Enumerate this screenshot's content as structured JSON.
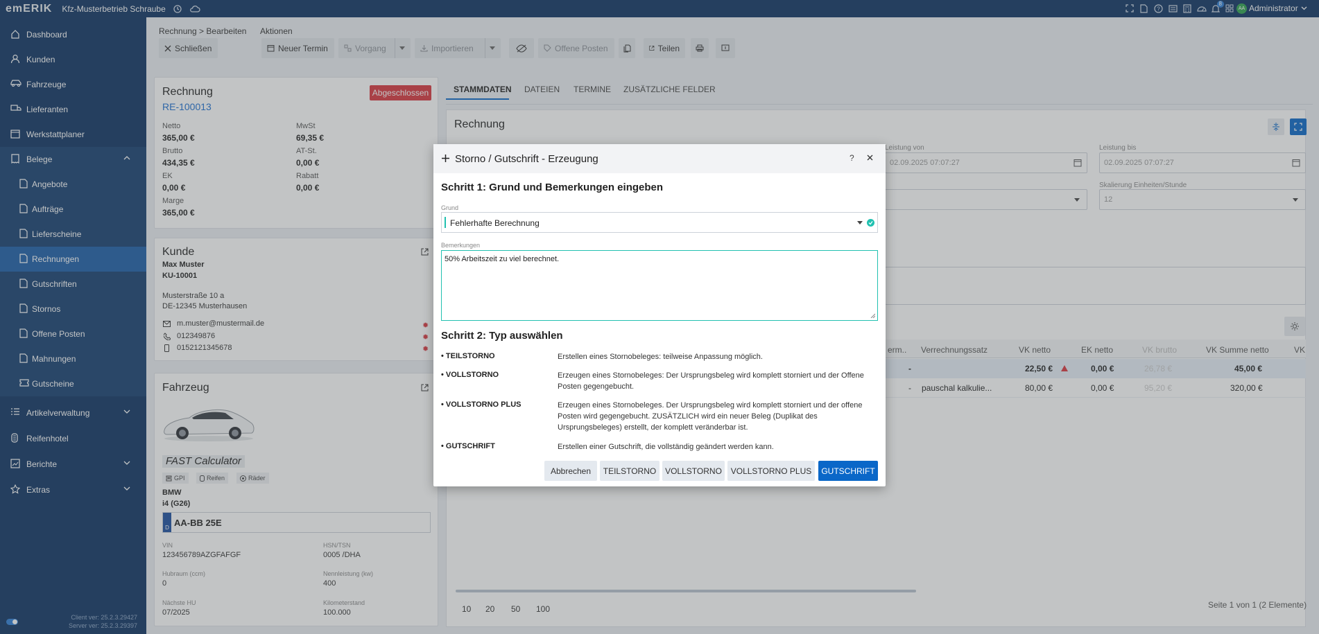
{
  "topbar": {
    "logo": "emERIK",
    "company": "Kfz-Musterbetrieb Schraube",
    "user": "Administrator",
    "avatar_initials": "AA",
    "notifications_count": "8"
  },
  "sidebar": {
    "items": [
      {
        "label": "Dashboard",
        "icon": "home-icon"
      },
      {
        "label": "Kunden",
        "icon": "user-icon"
      },
      {
        "label": "Fahrzeuge",
        "icon": "car-icon"
      },
      {
        "label": "Lieferanten",
        "icon": "truck-icon"
      },
      {
        "label": "Werkstattplaner",
        "icon": "calendar-icon"
      },
      {
        "label": "Belege",
        "icon": "receipt-icon"
      },
      {
        "label": "Angebote",
        "icon": "document-icon"
      },
      {
        "label": "Aufträge",
        "icon": "document-icon"
      },
      {
        "label": "Lieferscheine",
        "icon": "document-icon"
      },
      {
        "label": "Rechnungen",
        "icon": "document-icon"
      },
      {
        "label": "Gutschriften",
        "icon": "document-icon"
      },
      {
        "label": "Stornos",
        "icon": "document-icon"
      },
      {
        "label": "Offene Posten",
        "icon": "document-icon"
      },
      {
        "label": "Mahnungen",
        "icon": "document-icon"
      },
      {
        "label": "Gutscheine",
        "icon": "ticket-icon"
      },
      {
        "label": "Artikelverwaltung",
        "icon": "list-icon"
      },
      {
        "label": "Reifenhotel",
        "icon": "tire-icon"
      },
      {
        "label": "Berichte",
        "icon": "chart-icon"
      },
      {
        "label": "Extras",
        "icon": "star-icon"
      }
    ],
    "client_version": "Client ver: 25.2.3.29427",
    "server_version": "Server ver: 25.2.3.29397"
  },
  "toolbar": {
    "breadcrumb": "Rechnung > Bearbeiten",
    "actions_label": "Aktionen",
    "close": "Schließen",
    "new_appointment": "Neuer Termin",
    "process": "Vorgang",
    "import": "Importieren",
    "open_items": "Offene Posten",
    "share": "Teilen"
  },
  "invoice": {
    "title": "Rechnung",
    "number": "RE-100013",
    "status": "Abgeschlossen",
    "netto_label": "Netto",
    "netto": "365,00 €",
    "mwst_label": "MwSt",
    "mwst": "69,35 €",
    "brutto_label": "Brutto",
    "brutto": "434,35 €",
    "atst_label": "AT-St.",
    "atst": "0,00 €",
    "ek_label": "EK",
    "ek": "0,00 €",
    "rabatt_label": "Rabatt",
    "rabatt": "0,00 €",
    "marge_label": "Marge",
    "marge": "365,00 €"
  },
  "customer": {
    "title": "Kunde",
    "name": "Max Muster",
    "number": "KU-10001",
    "street": "Musterstraße 10 a",
    "city": "DE-12345 Musterhausen",
    "email": "m.muster@mustermail.de",
    "phone": "012349876",
    "mobile": "0152121345678"
  },
  "vehicle": {
    "title": "Fahrzeug",
    "calculator": "FAST Calculator",
    "chips": [
      "GPI",
      "Reifen",
      "Räder"
    ],
    "make": "BMW",
    "model": "i4 (G26)",
    "plate_country": "D",
    "plate": "AA-BB 25E",
    "vin_label": "VIN",
    "vin": "123456789AZGFAFGF",
    "hsn_label": "HSN/TSN",
    "hsn": "0005 /DHA",
    "hubraum_label": "Hubraum (ccm)",
    "hubraum": "0",
    "power_label": "Nennleistung (kw)",
    "power": "400",
    "hu_label": "Nächste HU",
    "hu": "07/2025",
    "km_label": "Kilometerstand",
    "km": "100.000"
  },
  "main": {
    "tabs": [
      "STAMMDATEN",
      "DATEIEN",
      "TERMINE",
      "ZUSÄTZLICHE FELDER"
    ],
    "section_title": "Rechnung",
    "leistung_von_label": "Leistung von",
    "leistung_von": "02.09.2025 07:07:27",
    "leistung_bis_label": "Leistung bis",
    "leistung_bis": "02.09.2025 07:07:27",
    "skalierung_label": "Skalierung Einheiten/Stunde",
    "skalierung": "12",
    "table_headers": [
      "erm..",
      "Verrechnungssatz",
      "VK netto",
      "EK netto",
      "VK brutto",
      "VK Summe netto",
      "VK"
    ],
    "rows": [
      {
        "erm": "-",
        "satz": "",
        "vk_netto": "22,50 €",
        "ek_netto": "0,00 €",
        "vk_brutto": "26,78 €",
        "vk_summe": "45,00 €"
      },
      {
        "erm": "-",
        "satz": "pauschal kalkulie...",
        "vk_netto": "80,00 €",
        "ek_netto": "0,00 €",
        "vk_brutto": "95,20 €",
        "vk_summe": "320,00 €"
      }
    ],
    "page_sizes": [
      "10",
      "20",
      "50",
      "100"
    ],
    "page_info": "Seite 1 von 1 (2 Elemente)"
  },
  "dialog": {
    "title": "Storno / Gutschrift - Erzeugung",
    "help": "?",
    "step1": "Schritt 1: Grund und Bemerkungen eingeben",
    "grund_label": "Grund",
    "grund_value": "Fehlerhafte Berechnung",
    "bemerkungen_label": "Bemerkungen",
    "bemerkungen_value": "50% Arbeitszeit zu viel berechnet.",
    "step2": "Schritt 2: Typ auswählen",
    "types": [
      {
        "name": "• TEILSTORNO",
        "desc": "Erstellen eines Stornobeleges: teilweise Anpassung möglich."
      },
      {
        "name": "• VOLLSTORNO",
        "desc": "Erzeugen eines Stornobeleges: Der Ursprungsbeleg wird komplett storniert und der Offene Posten gegengebucht."
      },
      {
        "name": "• VOLLSTORNO PLUS",
        "desc": "Erzeugen eines Stornobeleges. Der Ursprungsbeleg wird komplett storniert und der offene Posten wird gegengebucht. ZUSÄTZLICH wird ein neuer Beleg (Duplikat des Ursprungsbeleges) erstellt, der komplett veränderbar ist."
      },
      {
        "name": "• GUTSCHRIFT",
        "desc": "Erstellen einer Gutschrift, die vollständig geändert werden kann."
      }
    ],
    "buttons": {
      "cancel": "Abbrechen",
      "teil": "TEILSTORNO",
      "voll": "VOLLSTORNO",
      "vollplus": "VOLLSTORNO PLUS",
      "gutschrift": "GUTSCHRIFT"
    }
  },
  "colors": {
    "sidebar": "#0f3463",
    "active": "#1d5fa8",
    "primary": "#0a67c8",
    "danger": "#d9363e",
    "link": "#1d6fd1"
  }
}
